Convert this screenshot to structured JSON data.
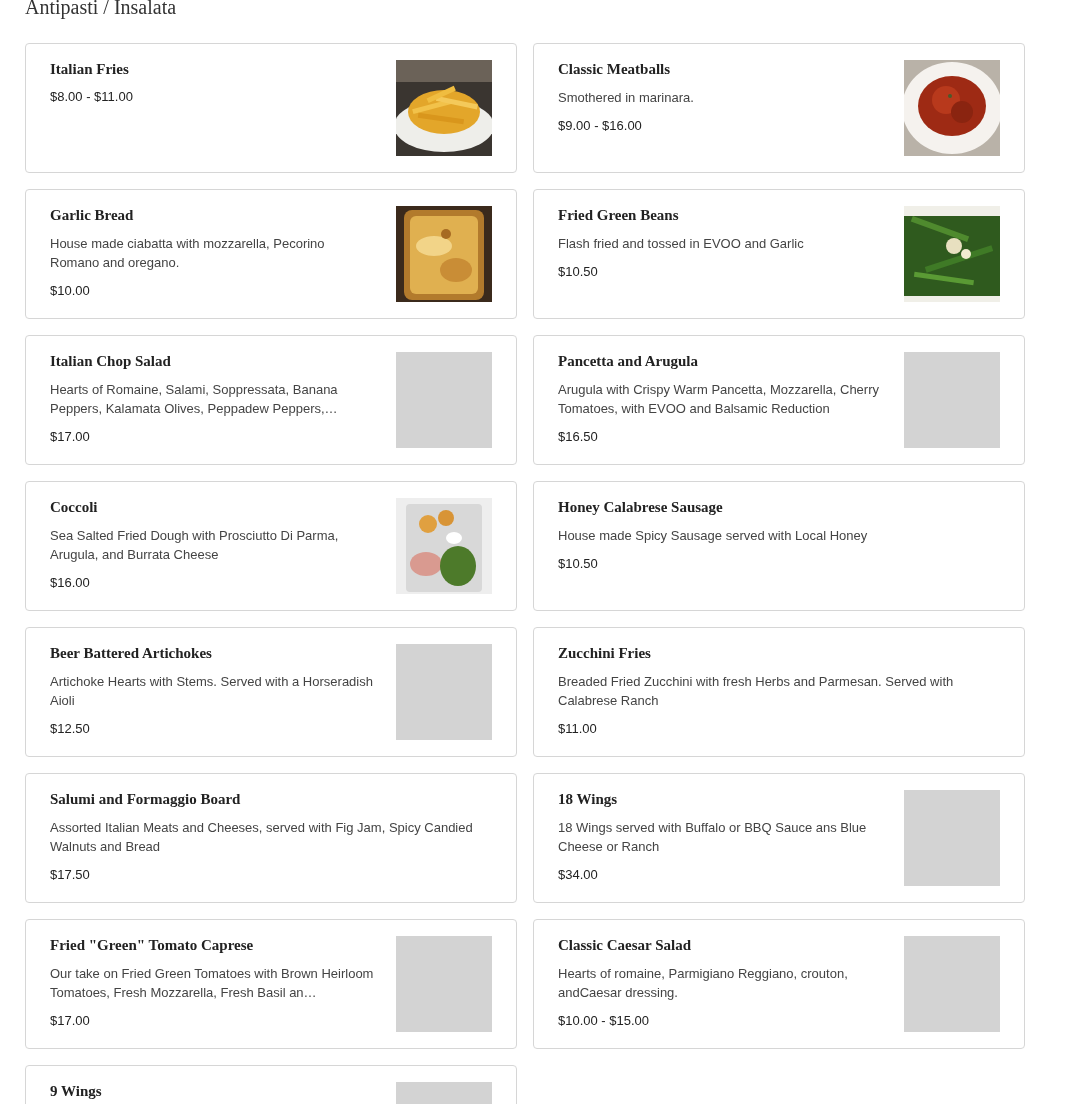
{
  "heading": "Antipasti / Insalata",
  "items": [
    {
      "name": "Italian Fries",
      "price": "$8.00 - $11.00",
      "image": {
        "kind": "fries"
      }
    },
    {
      "name": "Classic Meatballs",
      "description": "Smothered in marinara.",
      "price": "$9.00 - $16.00",
      "image": {
        "kind": "meatballs"
      }
    },
    {
      "name": "Garlic Bread",
      "description": "House made ciabatta with mozzarella, Pecorino Romano and oregano.",
      "price": "$10.00",
      "image": {
        "kind": "bread"
      }
    },
    {
      "name": "Fried Green Beans",
      "description": "Flash fried and tossed in EVOO and Garlic",
      "price": "$10.50",
      "image": {
        "kind": "beans"
      }
    },
    {
      "name": "Italian Chop Salad",
      "description": "Hearts of Romaine, Salami, Soppressata, Banana Peppers, Kalamata Olives, Peppadew Peppers,…",
      "price": "$17.00",
      "image": {
        "kind": "placeholder"
      }
    },
    {
      "name": "Pancetta and Arugula",
      "description": "Arugula with Crispy Warm Pancetta, Mozzarella, Cherry Tomatoes, with EVOO and Balsamic Reduction",
      "price": "$16.50",
      "image": {
        "kind": "placeholder"
      }
    },
    {
      "name": "Coccoli",
      "description": "Sea Salted Fried Dough with Prosciutto Di Parma, Arugula, and Burrata Cheese",
      "price": "$16.00",
      "image": {
        "kind": "platter"
      }
    },
    {
      "name": "Honey Calabrese Sausage",
      "description": "House made Spicy Sausage served with Local Honey",
      "price": "$10.50"
    },
    {
      "name": "Beer Battered Artichokes",
      "description": "Artichoke Hearts with Stems. Served with a Horseradish Aioli",
      "price": "$12.50",
      "image": {
        "kind": "placeholder"
      }
    },
    {
      "name": "Zucchini Fries",
      "description": "Breaded Fried Zucchini with fresh Herbs and Parmesan. Served with Calabrese Ranch",
      "price": "$11.00"
    },
    {
      "name": "Salumi and Formaggio Board",
      "description": "Assorted Italian Meats and Cheeses, served with Fig Jam, Spicy Candied Walnuts and Bread",
      "price": "$17.50"
    },
    {
      "name": "18 Wings",
      "description": "18 Wings served with Buffalo or BBQ Sauce ans Blue Cheese or Ranch",
      "price": "$34.00",
      "image": {
        "kind": "placeholder"
      }
    },
    {
      "name": "Fried \"Green\" Tomato Caprese",
      "description": "Our take on Fried Green Tomatoes with Brown Heirloom Tomatoes, Fresh Mozzarella, Fresh Basil an…",
      "price": "$17.00",
      "image": {
        "kind": "placeholder"
      }
    },
    {
      "name": "Classic Caesar Salad",
      "description": "Hearts of romaine, Parmigiano Reggiano, crouton, andCaesar dressing.",
      "price": "$10.00 - $15.00",
      "image": {
        "kind": "placeholder"
      }
    },
    {
      "name": "9 Wings",
      "image": {
        "kind": "placeholder"
      }
    }
  ]
}
